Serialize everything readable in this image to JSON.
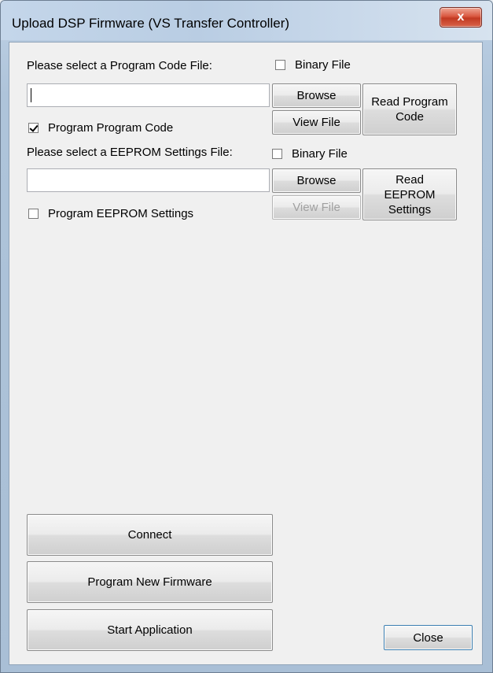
{
  "window": {
    "title": "Upload DSP Firmware (VS Transfer Controller)",
    "close_glyph": "x"
  },
  "program_code": {
    "prompt": "Please select a Program Code File:",
    "binary_label": "Binary File",
    "binary_checked": false,
    "file_value": "",
    "browse_label": "Browse",
    "view_label": "View File",
    "read_label": "Read Program\nCode",
    "program_label": "Program Program Code",
    "program_checked": true
  },
  "eeprom": {
    "prompt": "Please select a EEPROM Settings File:",
    "binary_label": "Binary File",
    "binary_checked": false,
    "file_value": "",
    "browse_label": "Browse",
    "view_label": "View File",
    "read_label": "Read\nEEPROM\nSettings",
    "program_label": "Program EEPROM Settings",
    "program_checked": false
  },
  "actions": {
    "connect_label": "Connect",
    "program_firmware_label": "Program New Firmware",
    "start_application_label": "Start Application",
    "close_label": "Close"
  }
}
